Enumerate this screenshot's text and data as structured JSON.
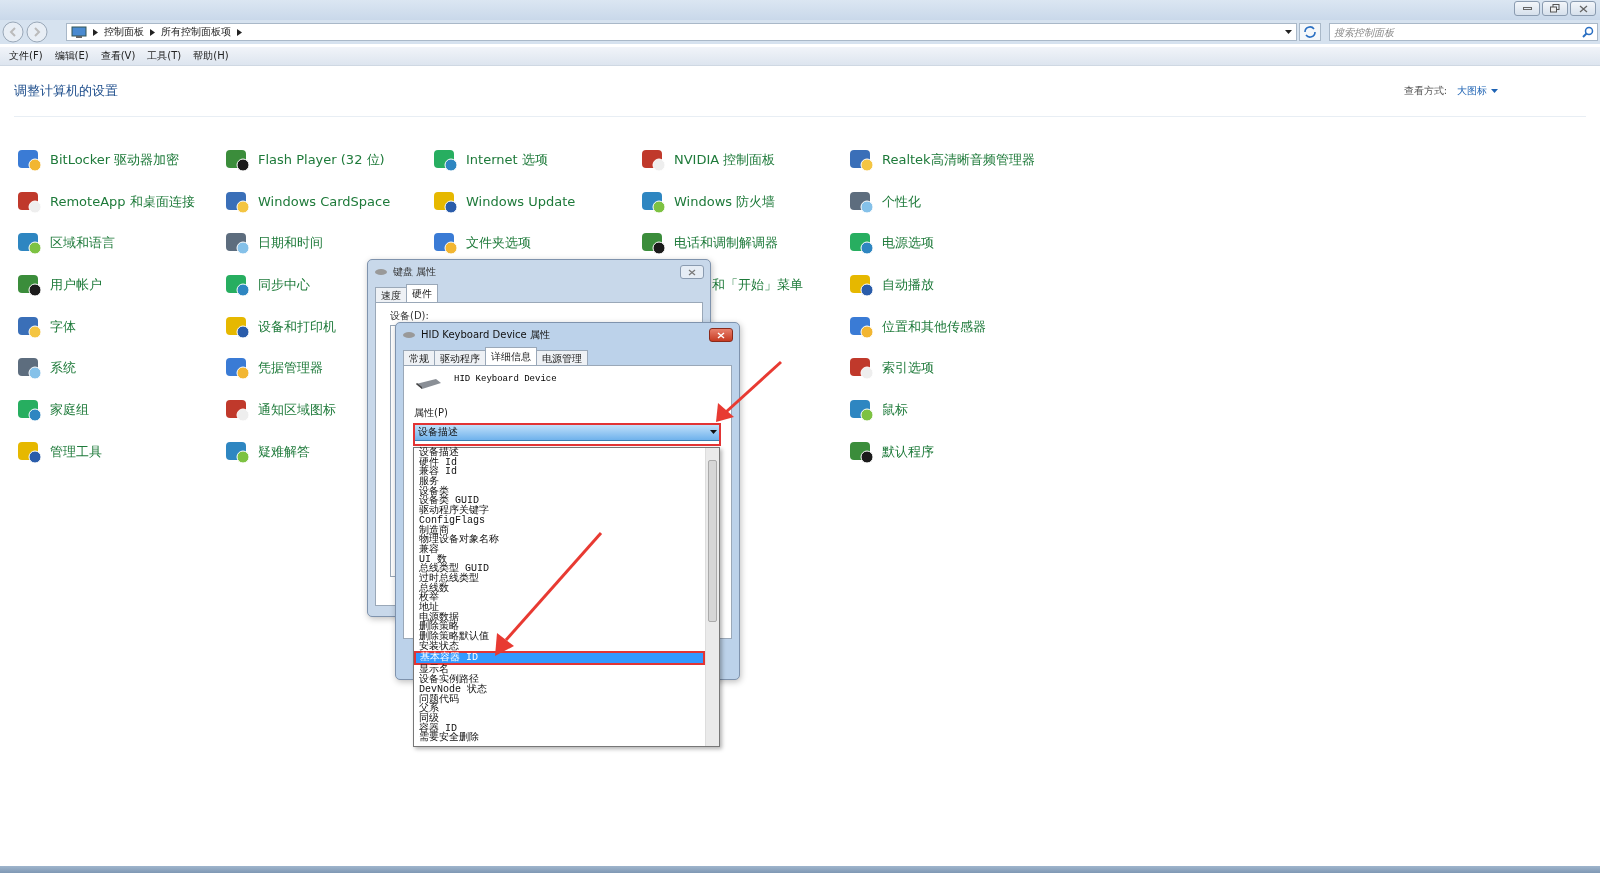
{
  "address_bar": {
    "crumbs": [
      "控制面板",
      "所有控制面板项"
    ]
  },
  "search": {
    "placeholder": "搜索控制面板"
  },
  "menu": [
    "文件(F)",
    "编辑(E)",
    "查看(V)",
    "工具(T)",
    "帮助(H)"
  ],
  "heading": "调整计算机的设置",
  "view": {
    "label": "查看方式:",
    "value": "大图标"
  },
  "columns": [
    [
      {
        "label": "BitLocker 驱动器加密",
        "kind": "full"
      },
      {
        "label": "RemoteApp 和桌面连接",
        "kind": "full"
      },
      {
        "label": "区域和语言",
        "kind": "full"
      },
      {
        "label": "用户帐户",
        "kind": "full"
      },
      {
        "label": "字体",
        "kind": "full"
      },
      {
        "label": "系统",
        "kind": "full"
      },
      {
        "label": "家庭组",
        "kind": "full"
      },
      {
        "label": "管理工具",
        "kind": "full"
      }
    ],
    [
      {
        "label": "Flash Player (32 位)",
        "kind": "full"
      },
      {
        "label": "Windows CardSpace",
        "kind": "full"
      },
      {
        "label": "日期和时间",
        "kind": "full"
      },
      {
        "label": "同步中心",
        "kind": "full"
      },
      {
        "label": "设备和打印机",
        "kind": "full"
      },
      {
        "label": "凭据管理器",
        "kind": "full"
      },
      {
        "label": "通知区域图标",
        "kind": "full"
      },
      {
        "label": "疑难解答",
        "kind": "full"
      }
    ],
    [
      {
        "label": "Internet 选项",
        "kind": "full"
      },
      {
        "label": "Windows Update",
        "kind": "full"
      },
      {
        "label": "文件夹选项",
        "kind": "full"
      }
    ],
    [
      {
        "label": "NVIDIA 控制面板",
        "kind": "full"
      },
      {
        "label": "Windows 防火墙",
        "kind": "full"
      },
      {
        "label": "电话和调制解调器",
        "kind": "full"
      },
      {
        "label": "和「开始」菜单",
        "kind": "partial"
      }
    ],
    [
      {
        "label": "Realtek高清晰音频管理器",
        "kind": "full"
      },
      {
        "label": "个性化",
        "kind": "full"
      },
      {
        "label": "电源选项",
        "kind": "full"
      },
      {
        "label": "自动播放",
        "kind": "full"
      },
      {
        "label": "位置和其他传感器",
        "kind": "full"
      },
      {
        "label": "索引选项",
        "kind": "full"
      },
      {
        "label": "鼠标",
        "kind": "full"
      },
      {
        "label": "默认程序",
        "kind": "full"
      }
    ]
  ],
  "keyboard_dialog": {
    "title": "键盘 属性",
    "tabs": [
      {
        "label": "速度",
        "selected": false
      },
      {
        "label": "硬件",
        "selected": true
      }
    ],
    "device_label": "设备(D):"
  },
  "device_dialog": {
    "title": "HID Keyboard Device 属性",
    "tabs": [
      {
        "label": "常规",
        "selected": false
      },
      {
        "label": "驱动程序",
        "selected": false
      },
      {
        "label": "详细信息",
        "selected": true
      },
      {
        "label": "电源管理",
        "selected": false
      }
    ],
    "device_name": "HID Keyboard Device",
    "property_label": "属性(P)",
    "property_value": "设备描述",
    "options": [
      {
        "label": "设备描述",
        "selected": false
      },
      {
        "label": "硬件 Id",
        "selected": false
      },
      {
        "label": "兼容 Id",
        "selected": false
      },
      {
        "label": "服务",
        "selected": false
      },
      {
        "label": "设备类",
        "selected": false
      },
      {
        "label": "设备类 GUID",
        "selected": false
      },
      {
        "label": "驱动程序关键字",
        "selected": false
      },
      {
        "label": "ConfigFlags",
        "selected": false
      },
      {
        "label": "制造商",
        "selected": false
      },
      {
        "label": "物理设备对象名称",
        "selected": false
      },
      {
        "label": "兼容",
        "selected": false
      },
      {
        "label": "UI 数",
        "selected": false
      },
      {
        "label": "总线类型 GUID",
        "selected": false
      },
      {
        "label": "过时总线类型",
        "selected": false
      },
      {
        "label": "总线数",
        "selected": false
      },
      {
        "label": "枚举",
        "selected": false
      },
      {
        "label": "地址",
        "selected": false
      },
      {
        "label": "电源数据",
        "selected": false
      },
      {
        "label": "删除策略",
        "selected": false
      },
      {
        "label": "删除策略默认值",
        "selected": false
      },
      {
        "label": "安装状态",
        "selected": false
      },
      {
        "label": "基本容器 ID",
        "selected": true
      },
      {
        "label": "显示名",
        "selected": false
      },
      {
        "label": "设备实例路径",
        "selected": false
      },
      {
        "label": "DevNode 状态",
        "selected": false
      },
      {
        "label": "问题代码",
        "selected": false
      },
      {
        "label": "父系",
        "selected": false
      },
      {
        "label": "同级",
        "selected": false
      },
      {
        "label": "容器 ID",
        "selected": false
      },
      {
        "label": "需要安全删除",
        "selected": false
      }
    ]
  }
}
